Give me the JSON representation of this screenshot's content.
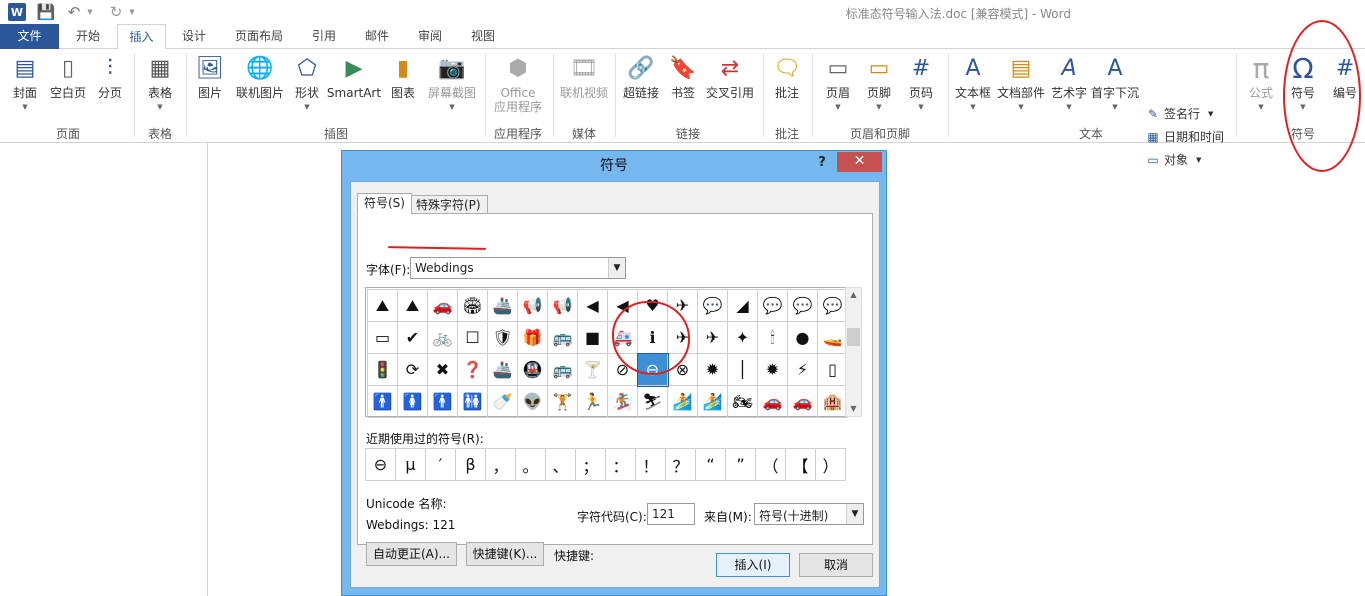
{
  "window": {
    "title": "标准态符号输入法.doc [兼容模式] - Word"
  },
  "quick_access": {
    "app_icon": "W"
  },
  "tabs": [
    "文件",
    "开始",
    "插入",
    "设计",
    "页面布局",
    "引用",
    "邮件",
    "审阅",
    "视图"
  ],
  "ribbon": {
    "buttons": {
      "cover": "封面",
      "blank": "空白页",
      "pagebreak": "分页",
      "table": "表格",
      "picture": "图片",
      "online_picture": "联机图片",
      "shapes": "形状",
      "smartart": "SmartArt",
      "chart": "图表",
      "screenshot": "屏幕截图",
      "office_apps": "Office\n应用程序",
      "online_video": "联机视频",
      "hyperlink": "超链接",
      "bookmark": "书签",
      "crossref": "交叉引用",
      "comment": "批注",
      "header": "页眉",
      "footer": "页脚",
      "pagenum": "页码",
      "textbox": "文本框",
      "quickparts": "文档部件",
      "wordart": "艺术字",
      "dropcap": "首字下沉",
      "signature": "签名行",
      "datetime": "日期和时间",
      "object": "对象",
      "equation": "公式",
      "symbol": "符号",
      "number": "编号"
    },
    "groups": [
      "页面",
      "表格",
      "插图",
      "应用程序",
      "媒体",
      "链接",
      "批注",
      "页眉和页脚",
      "文本",
      "符号"
    ]
  },
  "dialog": {
    "title": "符号",
    "help": "?",
    "close": "✕",
    "tab_symbols": "符号(S)",
    "tab_special": "特殊字符(P)",
    "font_label": "字体(F):",
    "font_value": "Webdings",
    "grid_rows": [
      [
        "⛰",
        "⛰",
        "🚗",
        "🏟",
        "🚢",
        "📢",
        "📢",
        "◀",
        "◀",
        "♥",
        "✈",
        "💬",
        "◢",
        "💬",
        "💬",
        "💬"
      ],
      [
        "▭",
        "✔",
        "🚲",
        "☐",
        "🛡",
        "🎁",
        "🚌",
        "■",
        "🚑",
        "ℹ",
        "✈",
        "✈",
        "✦",
        "🕯",
        "●",
        "🚤"
      ],
      [
        "🚦",
        "⟳",
        "✖",
        "❓",
        "🚢",
        "🚇",
        "🚌",
        "🍸",
        "⊘",
        "⊖",
        "⊗",
        "✹",
        "│",
        "✹",
        "⚡",
        "▯"
      ],
      [
        "🚹",
        "🚺",
        "🚹",
        "🚻",
        "🍼",
        "👽",
        "🏋",
        "🏃",
        "🏂",
        "⛷",
        "🏄",
        "🏄",
        "🏍",
        "🚗",
        "🚗",
        "🏨"
      ]
    ],
    "selected": {
      "row": 2,
      "col": 9
    },
    "recent_label": "近期使用过的符号(R):",
    "recent": [
      "⊖",
      "μ",
      "′",
      "β",
      "，",
      "。",
      "、",
      "；",
      "：",
      "！",
      "？",
      "“",
      "”",
      "（",
      "【",
      "）"
    ],
    "unicode_name_label": "Unicode 名称:",
    "unicode_info": "Webdings: 121",
    "code_label": "字符代码(C):",
    "code_value": "121",
    "from_label": "来自(M):",
    "from_value": "符号(十进制)",
    "autocorrect_btn": "自动更正(A)...",
    "shortcut_btn": "快捷键(K)...",
    "shortcut_label": "快捷键:",
    "insert_btn": "插入(I)",
    "cancel_btn": "取消"
  },
  "colors": {
    "accent": "#2b579a",
    "annotation": "#e02020",
    "selection": "#3d8fd6"
  }
}
